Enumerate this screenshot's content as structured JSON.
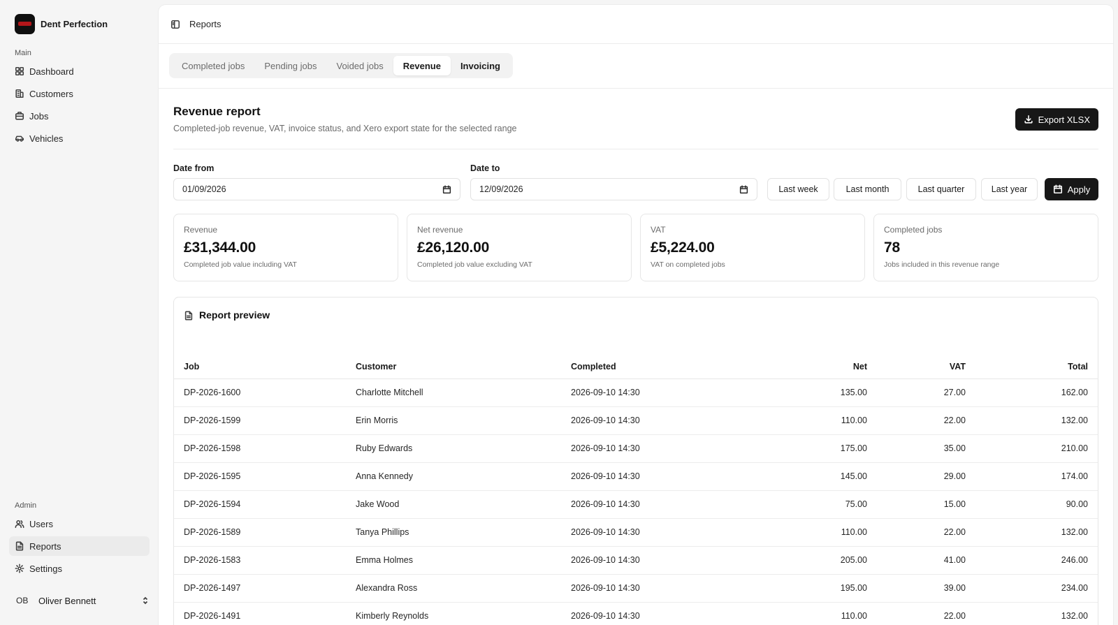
{
  "brand": {
    "name": "Dent Perfection",
    "logo_color": "#b3161a"
  },
  "sidebar": {
    "main_label": "Main",
    "main_items": [
      {
        "label": "Dashboard",
        "icon": "grid-icon"
      },
      {
        "label": "Customers",
        "icon": "building-icon"
      },
      {
        "label": "Jobs",
        "icon": "briefcase-icon"
      },
      {
        "label": "Vehicles",
        "icon": "car-icon"
      }
    ],
    "admin_label": "Admin",
    "admin_items": [
      {
        "label": "Users",
        "icon": "users-icon"
      },
      {
        "label": "Reports",
        "icon": "file-icon",
        "active": true
      },
      {
        "label": "Settings",
        "icon": "gear-icon"
      }
    ],
    "user": {
      "initials": "OB",
      "name": "Oliver Bennett"
    }
  },
  "topbar": {
    "title": "Reports"
  },
  "tabs": [
    {
      "label": "Completed jobs"
    },
    {
      "label": "Pending jobs"
    },
    {
      "label": "Voided jobs"
    },
    {
      "label": "Revenue",
      "active": true
    },
    {
      "label": "Invoicing"
    }
  ],
  "report": {
    "title": "Revenue report",
    "subtitle": "Completed-job revenue, VAT, invoice status, and Xero export state for the selected range",
    "export_label": "Export XLSX"
  },
  "filters": {
    "date_from_label": "Date from",
    "date_from_value": "01/09/2026",
    "date_to_label": "Date to",
    "date_to_value": "12/09/2026",
    "presets": [
      "Last week",
      "Last month",
      "Last quarter",
      "Last year"
    ],
    "apply_label": "Apply"
  },
  "stats": [
    {
      "label": "Revenue",
      "value": "£31,344.00",
      "desc": "Completed job value including VAT"
    },
    {
      "label": "Net revenue",
      "value": "£26,120.00",
      "desc": "Completed job value excluding VAT"
    },
    {
      "label": "VAT",
      "value": "£5,224.00",
      "desc": "VAT on completed jobs"
    },
    {
      "label": "Completed jobs",
      "value": "78",
      "desc": "Jobs included in this revenue range"
    }
  ],
  "preview": {
    "title": "Report preview",
    "columns": [
      "Job",
      "Customer",
      "Completed",
      "Net",
      "VAT",
      "Total"
    ],
    "rows": [
      [
        "DP-2026-1600",
        "Charlotte Mitchell",
        "2026-09-10 14:30",
        "135.00",
        "27.00",
        "162.00"
      ],
      [
        "DP-2026-1599",
        "Erin Morris",
        "2026-09-10 14:30",
        "110.00",
        "22.00",
        "132.00"
      ],
      [
        "DP-2026-1598",
        "Ruby Edwards",
        "2026-09-10 14:30",
        "175.00",
        "35.00",
        "210.00"
      ],
      [
        "DP-2026-1595",
        "Anna Kennedy",
        "2026-09-10 14:30",
        "145.00",
        "29.00",
        "174.00"
      ],
      [
        "DP-2026-1594",
        "Jake Wood",
        "2026-09-10 14:30",
        "75.00",
        "15.00",
        "90.00"
      ],
      [
        "DP-2026-1589",
        "Tanya Phillips",
        "2026-09-10 14:30",
        "110.00",
        "22.00",
        "132.00"
      ],
      [
        "DP-2026-1583",
        "Emma Holmes",
        "2026-09-10 14:30",
        "205.00",
        "41.00",
        "246.00"
      ],
      [
        "DP-2026-1497",
        "Alexandra Ross",
        "2026-09-10 14:30",
        "195.00",
        "39.00",
        "234.00"
      ],
      [
        "DP-2026-1491",
        "Kimberly Reynolds",
        "2026-09-10 14:30",
        "110.00",
        "22.00",
        "132.00"
      ]
    ]
  }
}
